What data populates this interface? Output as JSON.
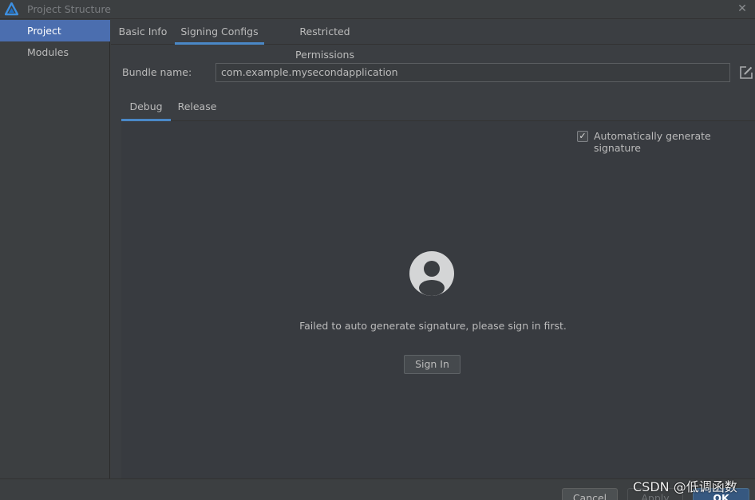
{
  "window": {
    "title": "Project Structure",
    "close_glyph": "✕"
  },
  "sidebar": {
    "items": [
      {
        "label": "Project",
        "selected": true
      },
      {
        "label": "Modules",
        "selected": false
      }
    ]
  },
  "tabs": [
    {
      "label": "Basic Info",
      "active": false
    },
    {
      "label": "Signing Configs",
      "active": true
    },
    {
      "label": "Restricted Permissions",
      "active": false
    }
  ],
  "bundle": {
    "label": "Bundle name:",
    "value": "com.example.mysecondapplication"
  },
  "subtabs": [
    {
      "label": "Debug",
      "active": true
    },
    {
      "label": "Release",
      "active": false
    }
  ],
  "auto_signature": {
    "label": "Automatically generate signature",
    "checked": true,
    "check_glyph": "✓"
  },
  "message": "Failed to auto generate signature, please sign in first.",
  "sign_in_label": "Sign In",
  "footer": {
    "cancel": "Cancel",
    "apply": "Apply",
    "ok": "OK"
  },
  "watermark": "CSDN @低调函数",
  "colors": {
    "accent": "#4a88c7",
    "selection": "#4b6eaf",
    "ok_button": "#365880",
    "background": "#3c3f41"
  },
  "icons": {
    "logo": "deveco-logo-icon",
    "edit": "edit-icon",
    "avatar": "user-avatar-icon",
    "close": "close-icon"
  }
}
